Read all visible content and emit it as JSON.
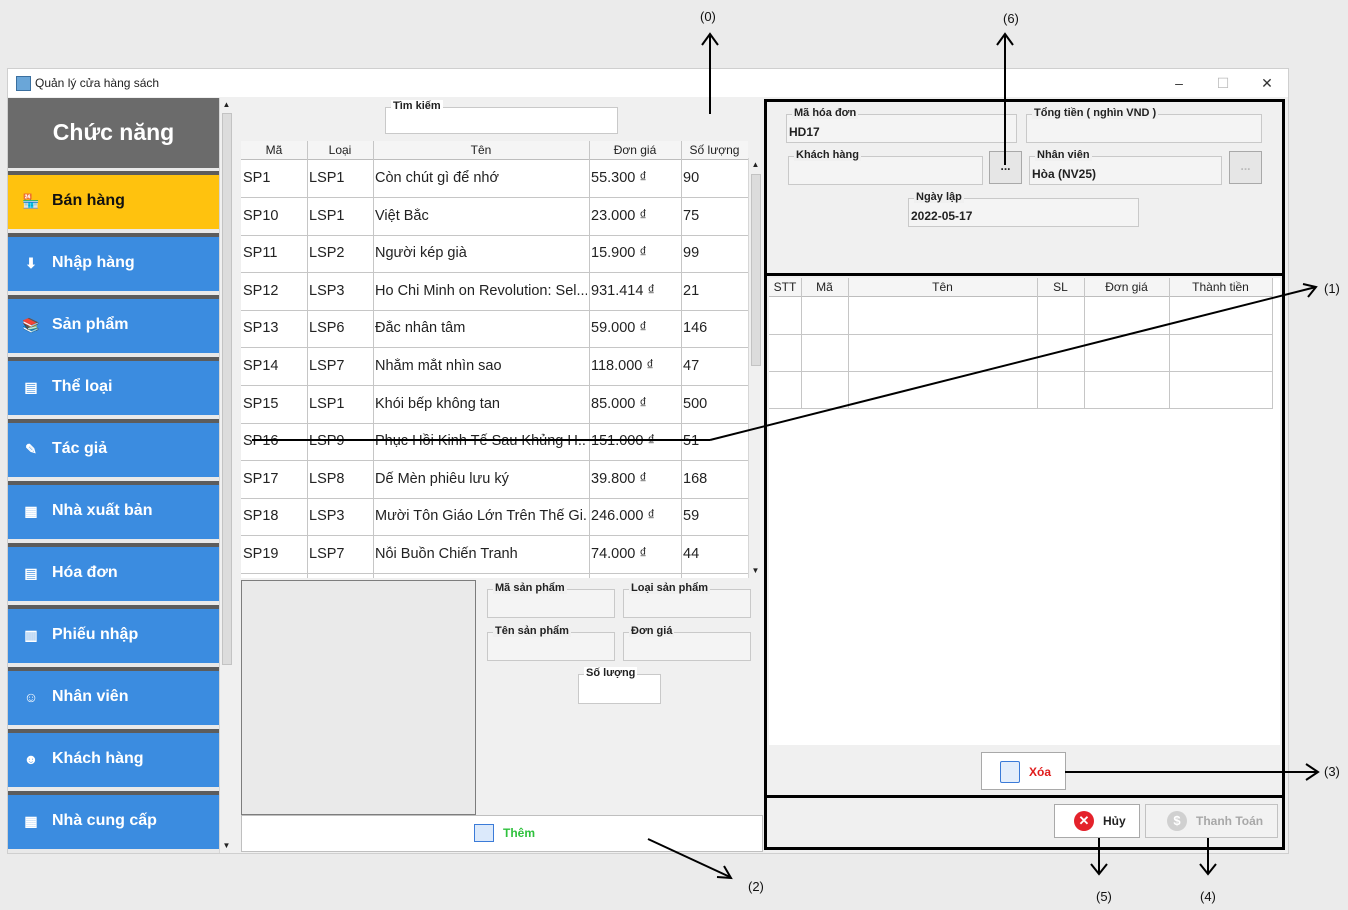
{
  "callouts": [
    "(0)",
    "(1)",
    "(2)",
    "(3)",
    "(4)",
    "(5)",
    "(6)"
  ],
  "window": {
    "title": "Quản lý cửa hàng sách",
    "minimize": "–",
    "maximize": "☐",
    "close": "✕"
  },
  "sidebar": {
    "heading": "Chức năng",
    "items": [
      {
        "label": "Bán hàng",
        "icon": "shop-icon",
        "active": true
      },
      {
        "label": "Nhập hàng",
        "icon": "import-icon"
      },
      {
        "label": "Sản phẩm",
        "icon": "product-icon"
      },
      {
        "label": "Thể loại",
        "icon": "category-icon"
      },
      {
        "label": "Tác giả",
        "icon": "author-icon"
      },
      {
        "label": "Nhà xuất bản",
        "icon": "building-icon"
      },
      {
        "label": "Hóa đơn",
        "icon": "invoice-icon"
      },
      {
        "label": "Phiếu nhập",
        "icon": "receipt-icon"
      },
      {
        "label": "Nhân viên",
        "icon": "employee-icon"
      },
      {
        "label": "Khách hàng",
        "icon": "customer-icon"
      },
      {
        "label": "Nhà cung cấp",
        "icon": "supplier-icon"
      }
    ]
  },
  "search": {
    "label": "Tìm kiếm",
    "value": ""
  },
  "products": {
    "columns": [
      "Mã",
      "Loại",
      "Tên",
      "Đơn giá",
      "Số lượng"
    ],
    "rows": [
      [
        "SP1",
        "LSP1",
        "Còn chút gì để nhớ",
        "55.300 ₫",
        "90"
      ],
      [
        "SP10",
        "LSP1",
        "Việt Bắc",
        "23.000 ₫",
        "75"
      ],
      [
        "SP11",
        "LSP2",
        "Người kép già",
        "15.900 ₫",
        "99"
      ],
      [
        "SP12",
        "LSP3",
        "Ho Chi Minh on Revolution: Sel...",
        "931.414 ₫",
        "21"
      ],
      [
        "SP13",
        "LSP6",
        "Đắc nhân tâm",
        "59.000 ₫",
        "146"
      ],
      [
        "SP14",
        "LSP7",
        "Nhắm mắt nhìn sao",
        "118.000 ₫",
        "47"
      ],
      [
        "SP15",
        "LSP1",
        "Khói bếp không tan",
        "85.000 ₫",
        "500"
      ],
      [
        "SP16",
        "LSP9",
        "Phục Hồi Kinh Tế Sau Khủng H...",
        "151.000 ₫",
        "51"
      ],
      [
        "SP17",
        "LSP8",
        "Dế Mèn phiêu lưu ký",
        "39.800 ₫",
        "168"
      ],
      [
        "SP18",
        "LSP3",
        "Mười Tôn Giáo Lớn Trên Thế Gi...",
        "246.000 ₫",
        "59"
      ],
      [
        "SP19",
        "LSP7",
        "Nỗi Buồn Chiến Tranh",
        "74.000 ₫",
        "44"
      ]
    ]
  },
  "product_detail": {
    "ma_label": "Mã sản phẩm",
    "loai_label": "Loại sản phẩm",
    "ten_label": "Tên sản phẩm",
    "gia_label": "Đơn giá",
    "sl_label": "Số lượng",
    "add_button": "Thêm"
  },
  "invoice": {
    "ma_label": "Mã hóa đơn",
    "ma_value": "HD17",
    "tong_label": "Tổng tiền ( nghìn VND )",
    "tong_value": "",
    "kh_label": "Khách hàng",
    "kh_value": "",
    "kh_button": "...",
    "nv_label": "Nhân viên",
    "nv_value": "Hòa (NV25)",
    "nv_button": "...",
    "ngay_label": "Ngày lập",
    "ngay_value": "2022-05-17",
    "columns": [
      "STT",
      "Mã",
      "Tên",
      "SL",
      "Đơn giá",
      "Thành tiền"
    ],
    "delete_button": "Xóa",
    "cancel_button": "Hủy",
    "pay_button": "Thanh Toán"
  }
}
